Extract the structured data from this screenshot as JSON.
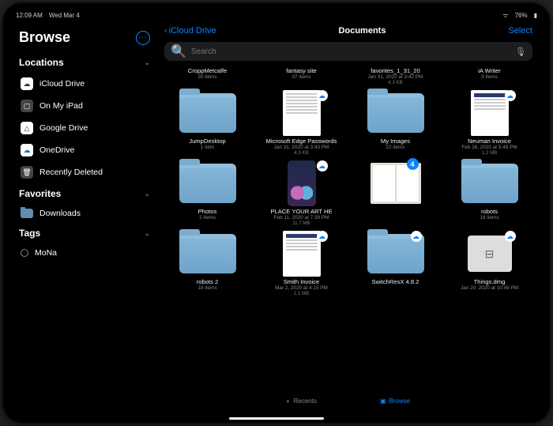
{
  "statusbar": {
    "time": "12:09 AM",
    "date": "Wed Mar 4",
    "battery": "76%"
  },
  "sidebar": {
    "title": "Browse",
    "sections": {
      "locations": {
        "header": "Locations",
        "items": [
          {
            "label": "iCloud Drive"
          },
          {
            "label": "On My iPad"
          },
          {
            "label": "Google Drive"
          },
          {
            "label": "OneDrive"
          },
          {
            "label": "Recently Deleted"
          }
        ]
      },
      "favorites": {
        "header": "Favorites",
        "items": [
          {
            "label": "Downloads"
          }
        ]
      },
      "tags": {
        "header": "Tags",
        "items": [
          {
            "label": "MoNa"
          }
        ]
      }
    }
  },
  "nav": {
    "back": "iCloud Drive",
    "title": "Documents",
    "select": "Select"
  },
  "search": {
    "placeholder": "Search"
  },
  "grid": {
    "row0": [
      {
        "name": "CroppMetcalfe",
        "meta": "30 items"
      },
      {
        "name": "fantasy site",
        "meta": "37 items"
      },
      {
        "name": "favorites_1_31_20",
        "meta": "Jan 31, 2020 at 3:42 PM",
        "meta2": "4.3 KB"
      },
      {
        "name": "iA Writer",
        "meta": "0 items"
      }
    ],
    "row1": [
      {
        "name": "JumpDesktop",
        "meta": "1 item"
      },
      {
        "name": "Microsoft Edge Passwords",
        "meta": "Jan 31, 2020 at 3:43 PM",
        "meta2": "4.3 KB"
      },
      {
        "name": "My Images",
        "meta": "22 items"
      },
      {
        "name": "Neuman Invoice",
        "meta": "Feb 26, 2020 at 5:48 PM",
        "meta2": "1.2 MB"
      }
    ],
    "row2": [
      {
        "name": "Photos",
        "meta": "2 items"
      },
      {
        "name": "PLACE YOUR ART HE",
        "meta": "Feb 11, 2020 at 7:39 PM",
        "meta2": "11.7 MB"
      },
      {
        "name": "",
        "meta": "",
        "badge": "4"
      },
      {
        "name": "robots",
        "meta": "18 items"
      }
    ],
    "row3": [
      {
        "name": "robots 2",
        "meta": "18 items"
      },
      {
        "name": "Smith Invoice",
        "meta": "Mar 2, 2020 at 4:15 PM",
        "meta2": "1.1 MB"
      },
      {
        "name": "SwitchResX 4.8.2",
        "meta": ""
      },
      {
        "name": "Things.dmg",
        "meta": "Jan 20, 2020 at 10:49 PM"
      }
    ]
  },
  "tabs": {
    "recents": "Recents",
    "browse": "Browse"
  }
}
